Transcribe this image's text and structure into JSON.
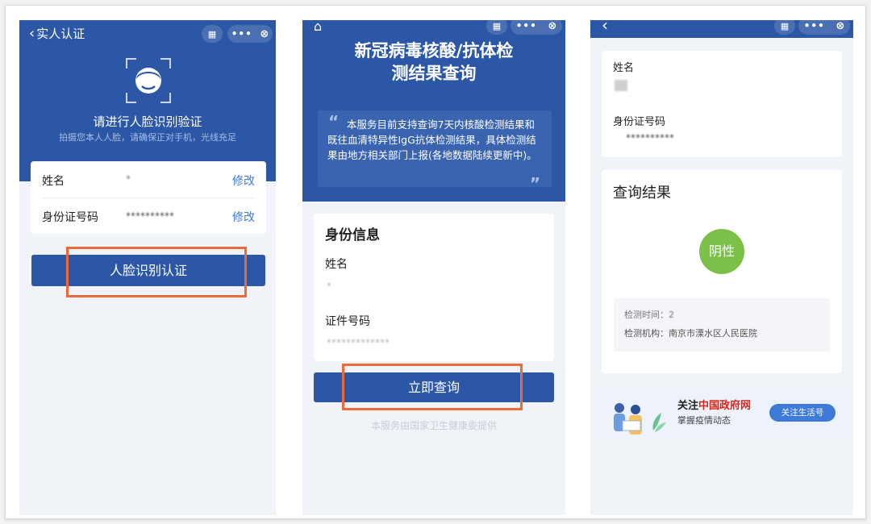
{
  "colors": {
    "primary_blue": "#2b57a6",
    "highlight_orange": "#ea6a3b",
    "link_blue": "#3e7ad6",
    "negative_green": "#7cc04a"
  },
  "screen1": {
    "title": "实人认证",
    "face_title": "请进行人脸识别验证",
    "face_subtitle": "拍摄您本人人脸，请确保正对手机，光线充足",
    "name_label": "姓名",
    "name_value": "*",
    "name_edit": "修改",
    "id_label": "身份证号码",
    "id_value": "**********",
    "id_edit": "修改",
    "button": "人脸识别认证"
  },
  "screen2": {
    "title_line1": "新冠病毒核酸/抗体检",
    "title_line2": "测结果查询",
    "notice": "本服务目前支持查询7天内核酸检测结果和既往血清特异性IgG抗体检测结果，具体检测结果由地方相关部门上报(各地数据陆续更新中)。",
    "section_title": "身份信息",
    "name_label": "姓名",
    "name_value": "*",
    "id_label": "证件号码",
    "id_value": "*************",
    "button": "立即查询",
    "footer": "本服务由国家卫生健康委提供"
  },
  "screen3": {
    "name_label": "姓名",
    "id_label": "身份证号码",
    "id_value": "**********",
    "result_title": "查询结果",
    "result_badge": "阴性",
    "test_time_label": "检测时间：",
    "test_time_value": "2",
    "test_org_label": "检测机构：",
    "test_org_value": "南京市溧水区人民医院",
    "banner_follow": "关注",
    "banner_brand": "中国政府网",
    "banner_sub": "掌握疫情动态",
    "banner_button": "关注生活号"
  }
}
